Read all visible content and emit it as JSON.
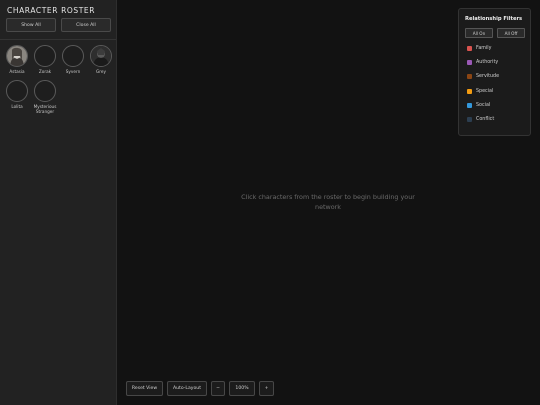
{
  "sidebar": {
    "title": "CHARACTER ROSTER",
    "show_all_label": "Show All",
    "close_all_label": "Close All",
    "characters": [
      {
        "name": "Astasia",
        "has_portrait": true
      },
      {
        "name": "Zorak",
        "has_portrait": false
      },
      {
        "name": "Syvern",
        "has_portrait": false
      },
      {
        "name": "Grey",
        "has_portrait": true
      },
      {
        "name": "Lolita",
        "has_portrait": false
      },
      {
        "name": "Mysterious Stranger",
        "has_portrait": false
      }
    ]
  },
  "canvas": {
    "empty_message": "Click characters from the roster to begin building your network"
  },
  "filters": {
    "title": "Relationship Filters",
    "all_on_label": "All On",
    "all_off_label": "All Off",
    "items": [
      {
        "label": "Family",
        "color": "#d9534f"
      },
      {
        "label": "Authority",
        "color": "#9b59b6"
      },
      {
        "label": "Servitude",
        "color": "#8b4513"
      },
      {
        "label": "Special",
        "color": "#f39c12"
      },
      {
        "label": "Social",
        "color": "#3498db"
      },
      {
        "label": "Conflict",
        "color": "#2c3e50"
      }
    ]
  },
  "toolbar": {
    "reset_view_label": "Reset View",
    "auto_layout_label": "Auto-Layout",
    "zoom_out_label": "−",
    "zoom_level": "100%",
    "zoom_in_label": "+"
  }
}
